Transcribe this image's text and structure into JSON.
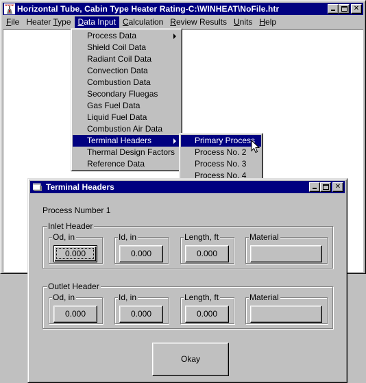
{
  "main_window": {
    "title": "Horizontal Tube, Cabin Type Heater Rating-C:\\WINHEAT\\NoFile.htr",
    "icon": "heater-app-icon",
    "controls": {
      "minimize": "minimize-icon",
      "maximize": "maximize-icon",
      "close": "close-icon"
    }
  },
  "menubar": {
    "items": [
      {
        "label": "File",
        "mnemonic": "F",
        "active": false
      },
      {
        "label": "Heater Type",
        "mnemonic": "T",
        "active": false
      },
      {
        "label": "Data Input",
        "mnemonic": "D",
        "active": true
      },
      {
        "label": "Calculation",
        "mnemonic": "C",
        "active": false
      },
      {
        "label": "Review Results",
        "mnemonic": "R",
        "active": false
      },
      {
        "label": "Units",
        "mnemonic": "U",
        "active": false
      },
      {
        "label": "Help",
        "mnemonic": "H",
        "active": false
      }
    ]
  },
  "data_input_menu": {
    "items": [
      {
        "label": "Process Data",
        "submenu": true,
        "highlighted": false
      },
      {
        "label": "Shield Coil Data",
        "submenu": false,
        "highlighted": false
      },
      {
        "label": "Radiant Coil Data",
        "submenu": false,
        "highlighted": false
      },
      {
        "label": "Convection Data",
        "submenu": false,
        "highlighted": false
      },
      {
        "label": "Combustion Data",
        "submenu": false,
        "highlighted": false
      },
      {
        "label": "Secondary Fluegas",
        "submenu": false,
        "highlighted": false
      },
      {
        "label": "Gas Fuel Data",
        "submenu": false,
        "highlighted": false
      },
      {
        "label": "Liquid Fuel Data",
        "submenu": false,
        "highlighted": false
      },
      {
        "label": "Combustion Air Data",
        "submenu": false,
        "highlighted": false
      },
      {
        "label": "Terminal Headers",
        "submenu": true,
        "highlighted": true
      },
      {
        "label": "Thermal Design Factors",
        "submenu": false,
        "highlighted": false
      },
      {
        "label": "Reference Data",
        "submenu": false,
        "highlighted": false
      }
    ]
  },
  "terminal_headers_submenu": {
    "items": [
      {
        "label": "Primary Process",
        "highlighted": true
      },
      {
        "label": "Process No. 2",
        "highlighted": false
      },
      {
        "label": "Process No. 3",
        "highlighted": false
      },
      {
        "label": "Process No. 4",
        "highlighted": false
      }
    ]
  },
  "dialog": {
    "title": "Terminal Headers",
    "icon": "form-icon",
    "process_label": "Process Number 1",
    "inlet": {
      "label": "Inlet Header",
      "od": {
        "label": "Od, in",
        "value": "0.000"
      },
      "id": {
        "label": "Id, in",
        "value": "0.000"
      },
      "length": {
        "label": "Length, ft",
        "value": "0.000"
      },
      "material": {
        "label": "Material",
        "value": ""
      }
    },
    "outlet": {
      "label": "Outlet Header",
      "od": {
        "label": "Od, in",
        "value": "0.000"
      },
      "id": {
        "label": "Id, in",
        "value": "0.000"
      },
      "length": {
        "label": "Length, ft",
        "value": "0.000"
      },
      "material": {
        "label": "Material",
        "value": ""
      }
    },
    "okay_label": "Okay"
  }
}
